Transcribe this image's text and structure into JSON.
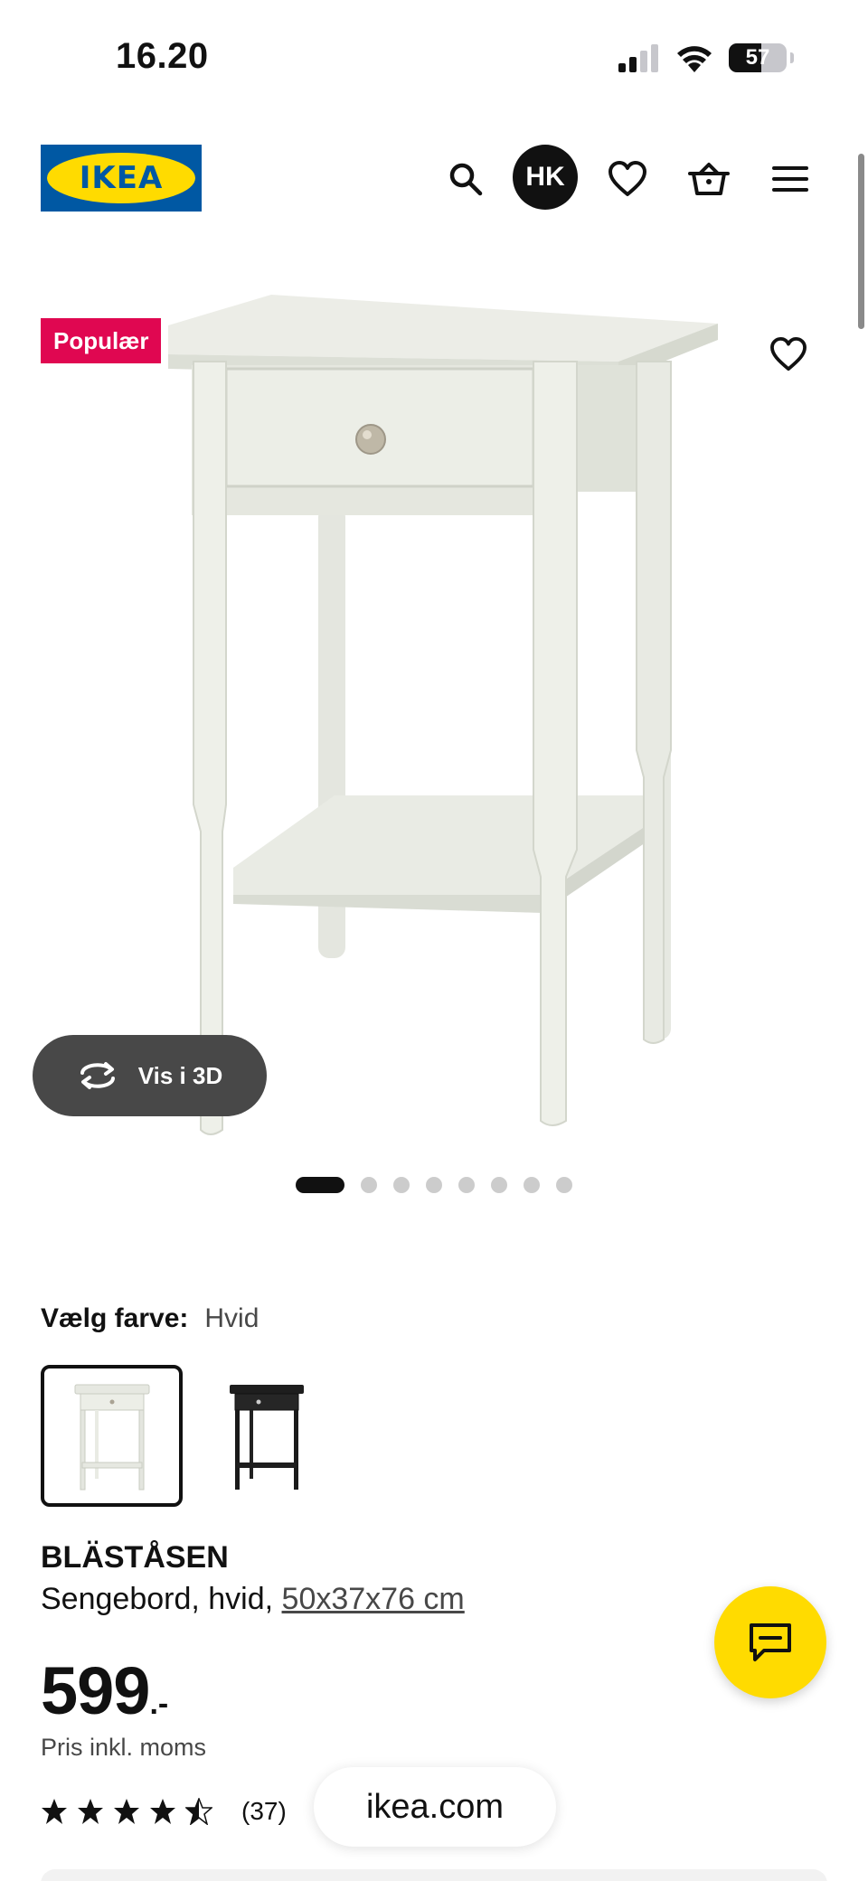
{
  "status_bar": {
    "time": "16.20",
    "battery_level": "57"
  },
  "header": {
    "logo_text": "IKEA",
    "avatar_initials": "HK"
  },
  "product_image": {
    "badge": "Populær",
    "view_3d_label": "Vis i 3D",
    "carousel": {
      "total": 8,
      "active": 1
    }
  },
  "color_picker": {
    "label": "Vælg farve:",
    "selected": "Hvid",
    "options": [
      "Hvid",
      "Sort"
    ]
  },
  "product": {
    "name": "BLÄSTÅSEN",
    "description": "Sengebord, hvid, ",
    "dimensions": "50x37x76 cm",
    "price": "599",
    "price_suffix": ".-",
    "price_note": "Pris inkl. moms",
    "rating": 4.5,
    "review_count": "(37)"
  },
  "browser": {
    "url": "ikea.com"
  },
  "colors": {
    "brand_blue": "#0058a3",
    "brand_yellow": "#ffdb00",
    "badge_red": "#e00751"
  }
}
